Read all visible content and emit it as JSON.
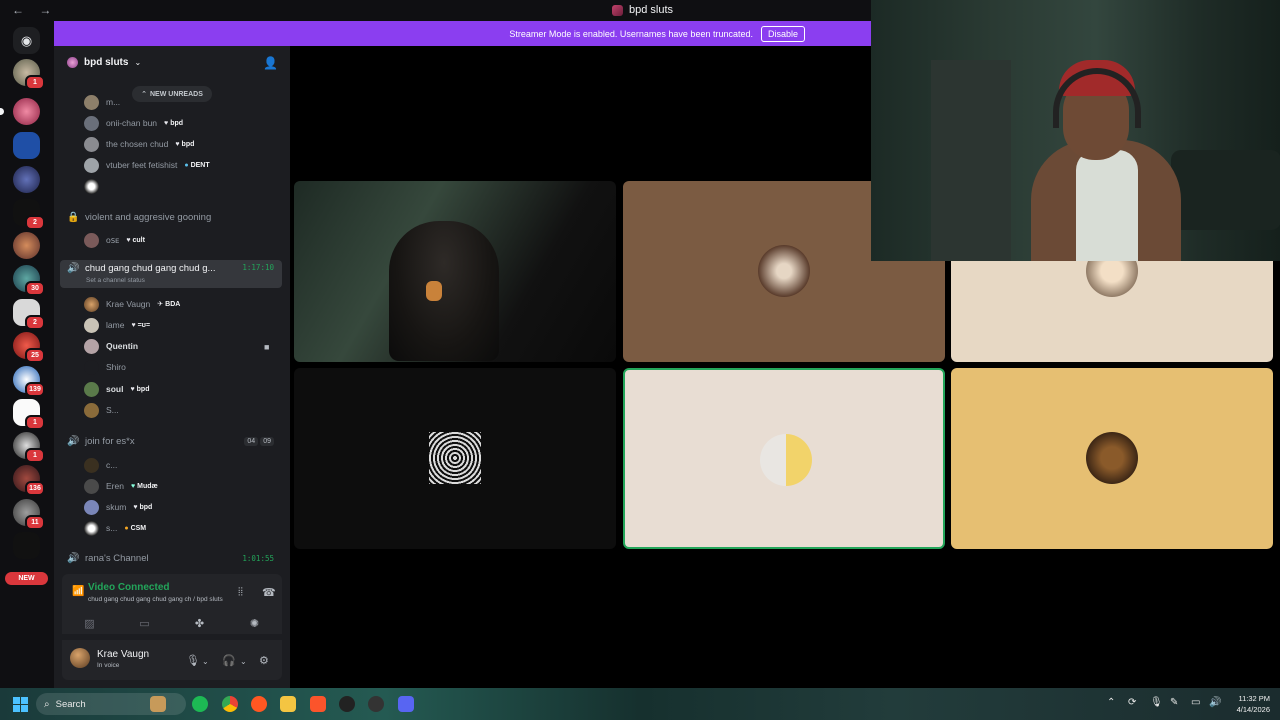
{
  "window": {
    "nav": "← →",
    "title": "bpd sluts"
  },
  "banner": {
    "message": "Streamer Mode is enabled. Usernames have been truncated.",
    "button": "Disable"
  },
  "guild_badges": [
    "1",
    "2",
    "30",
    "2",
    "25",
    "139",
    "1",
    "1",
    "136",
    "11"
  ],
  "guild_new": "NEW",
  "server": {
    "name": "bpd sluts",
    "chevron": "⌄",
    "new_unreads": "NEW UNREADS"
  },
  "members_top": [
    {
      "name": "m...",
      "tag": ""
    },
    {
      "name": "onii-chan bun",
      "tag": "bpd"
    },
    {
      "name": "the chosen chud",
      "tag": "bpd"
    },
    {
      "name": "vtuber feet fetishist",
      "tag": "DENT"
    }
  ],
  "channel_locked": {
    "name": "violent and aggresive gooning",
    "member": "cult",
    "member_name": "ᴏꜱᴇ"
  },
  "channel_active": {
    "name": "chud gang chud gang chud g...",
    "timer": "1:17:10",
    "status": "Set a channel status"
  },
  "active_members": [
    {
      "name": "Krae Vaugn",
      "tag": "BDA"
    },
    {
      "name": "lame",
      "tag": "=ʊ="
    },
    {
      "name": "Quentin",
      "tag": ""
    },
    {
      "name": "Shiro",
      "tag": ""
    },
    {
      "name": "soul",
      "tag": "bpd"
    },
    {
      "name": "S...",
      "tag": ""
    }
  ],
  "channel_join": {
    "name": "join for es*x",
    "count_a": "04",
    "count_b": "09"
  },
  "join_members": [
    {
      "name": "c...",
      "tag": ""
    },
    {
      "name": "Eren",
      "tag": "Mudæ"
    },
    {
      "name": "skum",
      "tag": "bpd"
    },
    {
      "name": "s...",
      "tag": "CSM"
    }
  ],
  "channel_rana": {
    "name": "rana's Channel",
    "timer": "1:01:55"
  },
  "voice": {
    "status": "Video Connected",
    "location": "chud gang chud gang chud gang ch / bpd sluts"
  },
  "user": {
    "name": "Krae Vaugn",
    "status": "In voice"
  },
  "taskbar": {
    "search": "Search",
    "time": "11:32 PM",
    "date": "4/14/2026"
  },
  "colors": {
    "accent": "#8b3ef0",
    "voice_green": "#23a55a",
    "mention_red": "#da373c"
  }
}
